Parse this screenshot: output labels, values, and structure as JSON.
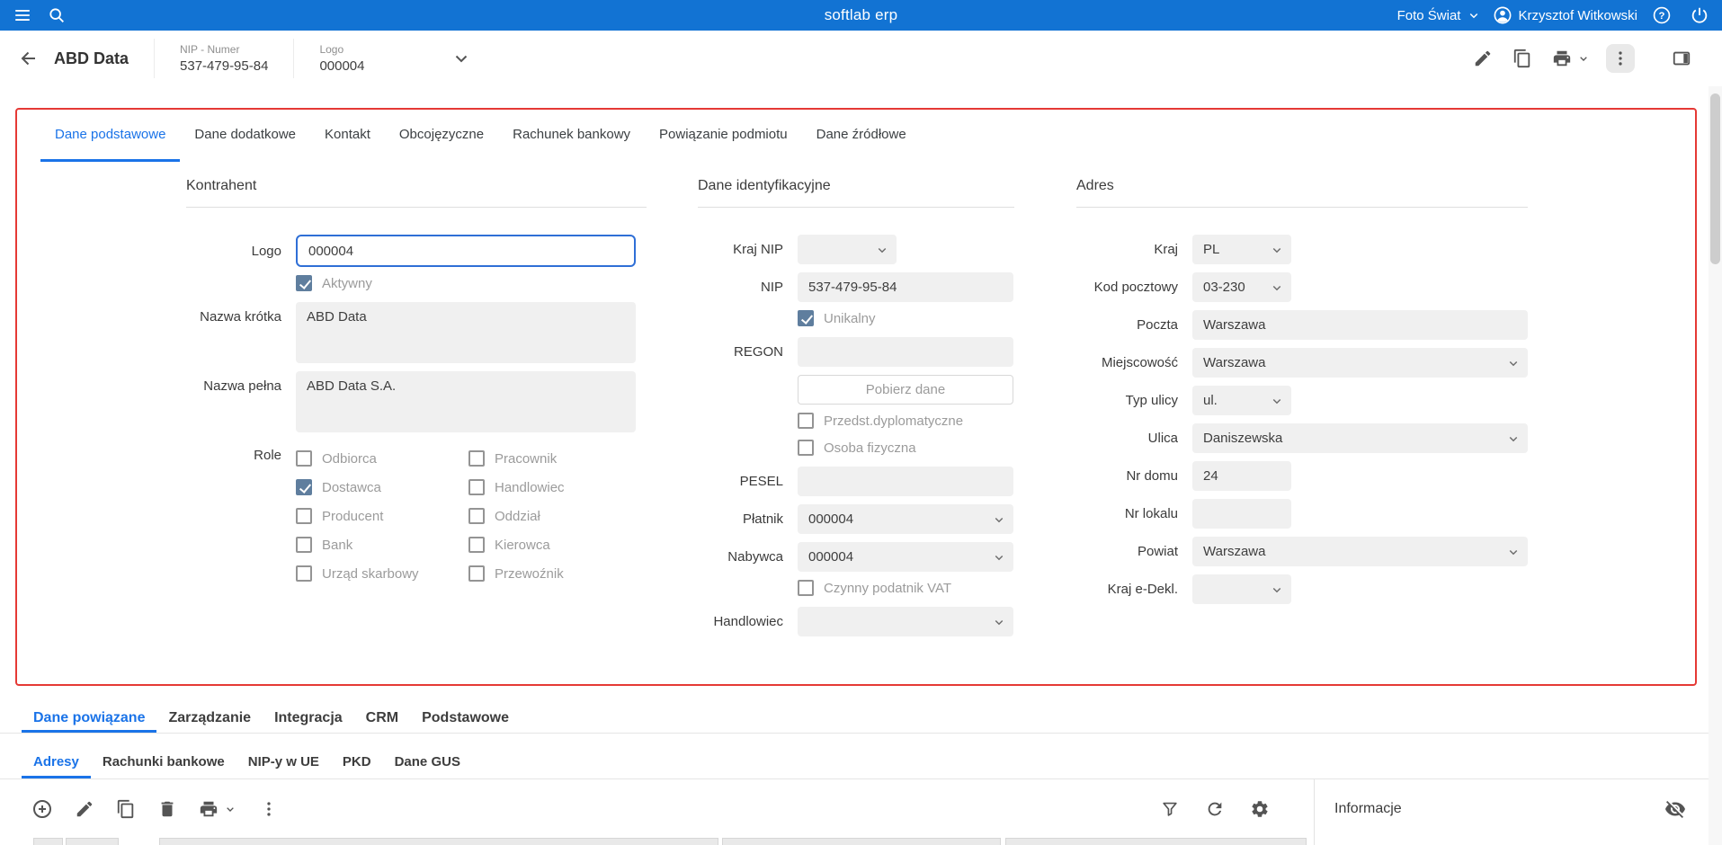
{
  "colors": {
    "topbar_bg": "#1273d3",
    "accent_blue": "#1a73e8",
    "highlight_border_red": "#e53935",
    "checkbox_checked": "#5f7e9e",
    "input_bg": "#f0f0f0"
  },
  "topbar": {
    "title": "softlab erp",
    "company": "Foto Świat",
    "user": "Krzysztof Witkowski"
  },
  "record_toolbar": {
    "title": "ABD Data",
    "nip": {
      "label": "NIP - Numer",
      "value": "537-479-95-84"
    },
    "logo": {
      "label": "Logo",
      "value": "000004"
    }
  },
  "main_tabs": {
    "items": [
      {
        "label": "Dane podstawowe",
        "active": true
      },
      {
        "label": "Dane dodatkowe",
        "active": false
      },
      {
        "label": "Kontakt",
        "active": false
      },
      {
        "label": "Obcojęzyczne",
        "active": false
      },
      {
        "label": "Rachunek bankowy",
        "active": false
      },
      {
        "label": "Powiązanie podmiotu",
        "active": false
      },
      {
        "label": "Dane źródłowe",
        "active": false
      }
    ]
  },
  "form": {
    "kontrahent": {
      "title": "Kontrahent",
      "logo_label": "Logo",
      "logo_value": "000004",
      "aktywny_label": "Aktywny",
      "aktywny_checked": true,
      "nazwa_krotka_label": "Nazwa krótka",
      "nazwa_krotka_value": "ABD Data",
      "nazwa_pelna_label": "Nazwa pełna",
      "nazwa_pelna_value": "ABD Data S.A.",
      "role_label": "Role",
      "role_col1": [
        {
          "label": "Odbiorca",
          "checked": false
        },
        {
          "label": "Dostawca",
          "checked": true
        },
        {
          "label": "Producent",
          "checked": false
        },
        {
          "label": "Bank",
          "checked": false
        },
        {
          "label": "Urząd skarbowy",
          "checked": false
        }
      ],
      "role_col2": [
        {
          "label": "Pracownik",
          "checked": false
        },
        {
          "label": "Handlowiec",
          "checked": false
        },
        {
          "label": "Oddział",
          "checked": false
        },
        {
          "label": "Kierowca",
          "checked": false
        },
        {
          "label": "Przewoźnik",
          "checked": false
        }
      ]
    },
    "identyfikacja": {
      "title": "Dane identyfikacyjne",
      "kraj_nip_label": "Kraj NIP",
      "kraj_nip_value": "",
      "nip_label": "NIP",
      "nip_value": "537-479-95-84",
      "unikalny_label": "Unikalny",
      "unikalny_checked": true,
      "regon_label": "REGON",
      "regon_value": "",
      "pobierz_dane_button": "Pobierz dane",
      "przedst_label": "Przedst.dyplomatyczne",
      "przedst_checked": false,
      "osoba_fizyczna_label": "Osoba fizyczna",
      "osoba_fizyczna_checked": false,
      "pesel_label": "PESEL",
      "pesel_value": "",
      "platnik_label": "Płatnik",
      "platnik_value": "000004",
      "nabywca_label": "Nabywca",
      "nabywca_value": "000004",
      "vat_label": "Czynny podatnik VAT",
      "vat_checked": false,
      "handlowiec_label": "Handlowiec",
      "handlowiec_value": ""
    },
    "adres": {
      "title": "Adres",
      "kraj_label": "Kraj",
      "kraj_value": "PL",
      "kod_label": "Kod pocztowy",
      "kod_value": "03-230",
      "poczta_label": "Poczta",
      "poczta_value": "Warszawa",
      "miejscowosc_label": "Miejscowość",
      "miejscowosc_value": "Warszawa",
      "typ_ulicy_label": "Typ ulicy",
      "typ_ulicy_value": "ul.",
      "ulica_label": "Ulica",
      "ulica_value": "Daniszewska",
      "nr_domu_label": "Nr domu",
      "nr_domu_value": "24",
      "nr_lokalu_label": "Nr lokalu",
      "nr_lokalu_value": "",
      "powiat_label": "Powiat",
      "powiat_value": "Warszawa",
      "kraj_edekl_label": "Kraj e-Dekl.",
      "kraj_edekl_value": ""
    }
  },
  "lower_tabs": {
    "items": [
      {
        "label": "Dane powiązane",
        "active": true
      },
      {
        "label": "Zarządzanie",
        "active": false
      },
      {
        "label": "Integracja",
        "active": false
      },
      {
        "label": "CRM",
        "active": false
      },
      {
        "label": "Podstawowe",
        "active": false
      }
    ]
  },
  "sub_tabs": {
    "items": [
      {
        "label": "Adresy",
        "active": true
      },
      {
        "label": "Rachunki bankowe",
        "active": false
      },
      {
        "label": "NIP-y w UE",
        "active": false
      },
      {
        "label": "PKD",
        "active": false
      },
      {
        "label": "Dane GUS",
        "active": false
      }
    ]
  },
  "info_panel": {
    "title": "Informacje"
  }
}
